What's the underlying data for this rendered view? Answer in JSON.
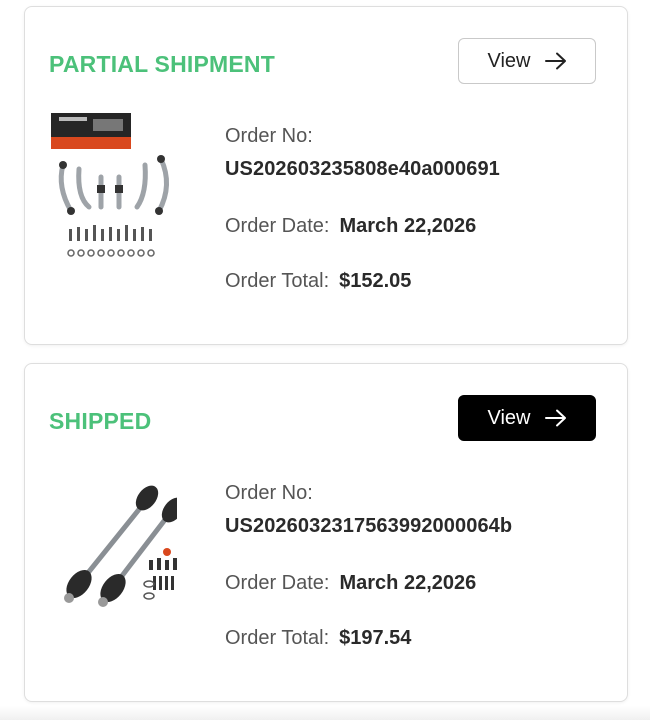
{
  "accent": "#4cc17a",
  "orders": [
    {
      "status": "PARTIAL SHIPMENT",
      "view_label": "View",
      "order_no_label": "Order No:",
      "order_no": "US202603235808e40a000691",
      "order_date_label": "Order Date:",
      "order_date": "March 22,2026",
      "order_total_label": "Order Total:",
      "order_total": "$152.05",
      "thumbnail": "control-arm-kit-image"
    },
    {
      "status": "SHIPPED",
      "view_label": "View",
      "order_no_label": "Order No:",
      "order_no": "US2026032317563992000064b",
      "order_date_label": "Order Date:",
      "order_date": "March 22,2026",
      "order_total_label": "Order Total:",
      "order_total": "$197.54",
      "thumbnail": "cv-axle-shafts-image"
    }
  ]
}
